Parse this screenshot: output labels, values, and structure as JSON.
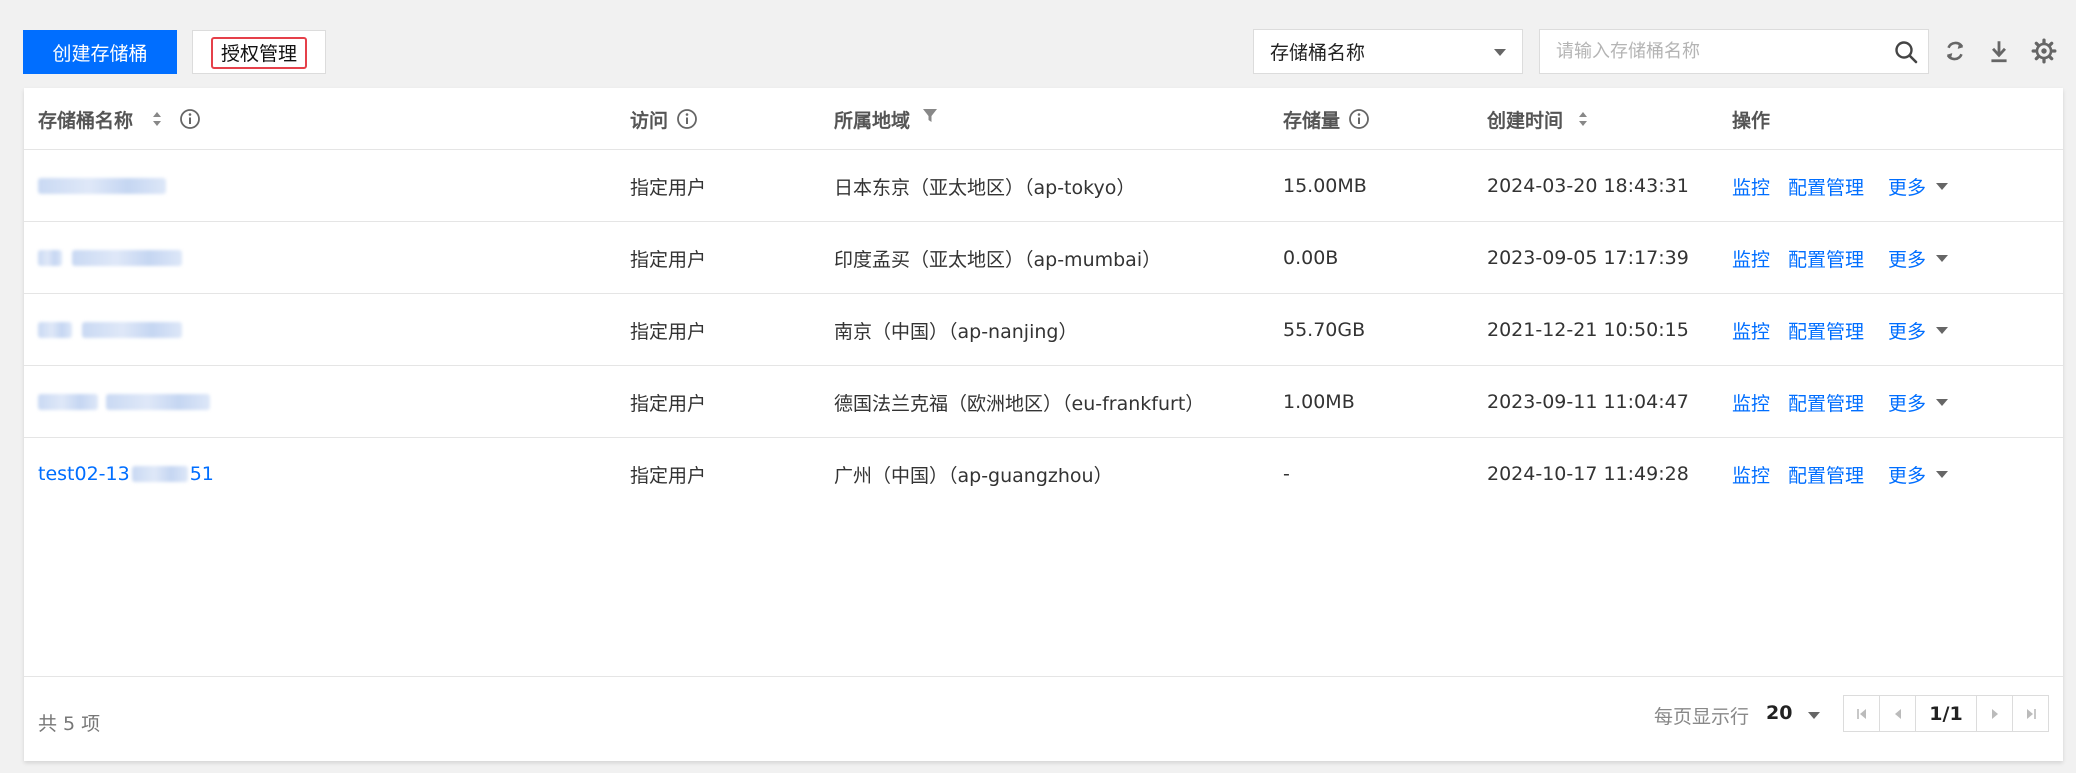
{
  "toolbar": {
    "create_label": "创建存储桶",
    "auth_label": "授权管理",
    "select_value": "存储桶名称",
    "search_placeholder": "请输入存储桶名称"
  },
  "table": {
    "headers": {
      "name": "存储桶名称",
      "access": "访问",
      "region": "所属地域",
      "storage": "存储量",
      "created": "创建时间",
      "ops": "操作"
    },
    "rows": [
      {
        "name": "",
        "name_blurred": true,
        "access": "指定用户",
        "region": "日本东京（亚太地区）（ap-tokyo）",
        "storage": "15.00MB",
        "created": "2024-03-20 18:43:31"
      },
      {
        "name": "",
        "name_blurred": true,
        "access": "指定用户",
        "region": "印度孟买（亚太地区）（ap-mumbai）",
        "storage": "0.00B",
        "created": "2023-09-05 17:17:39"
      },
      {
        "name": "",
        "name_blurred": true,
        "access": "指定用户",
        "region": "南京（中国）（ap-nanjing）",
        "storage": "55.70GB",
        "created": "2021-12-21 10:50:15"
      },
      {
        "name": "",
        "name_blurred": true,
        "access": "指定用户",
        "region": "德国法兰克福（欧洲地区）（eu-frankfurt）",
        "storage": "1.00MB",
        "created": "2023-09-11 11:04:47"
      },
      {
        "name_prefix": "test02-13",
        "name_suffix": "51",
        "name_blurred": "partial",
        "access": "指定用户",
        "region": "广州（中国）（ap-guangzhou）",
        "storage": "-",
        "created": "2024-10-17 11:49:28"
      }
    ],
    "row_actions": {
      "monitor": "监控",
      "config": "配置管理",
      "more": "更多"
    }
  },
  "footer": {
    "total": "共 5 项",
    "per_page_label": "每页显示行",
    "per_page_value": "20",
    "page": "1/1"
  }
}
